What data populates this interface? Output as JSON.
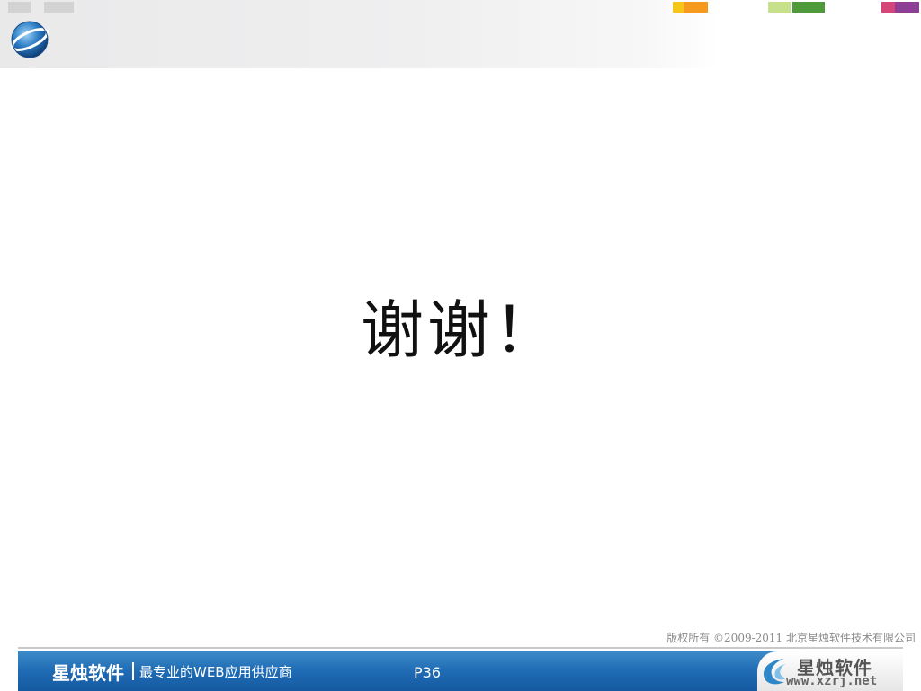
{
  "header": {
    "logo_icon": "globe-orbit-icon",
    "swatches": [
      {
        "name": "swatch-yellow-light",
        "color": "#f5c518"
      },
      {
        "name": "swatch-orange",
        "color": "#f59a1c"
      },
      {
        "name": "swatch-green-light",
        "color": "#c7e08c"
      },
      {
        "name": "swatch-green",
        "color": "#4f9a3a"
      },
      {
        "name": "swatch-pink",
        "color": "#d6457a"
      },
      {
        "name": "swatch-purple",
        "color": "#8d3f95"
      }
    ]
  },
  "slide": {
    "title": "谢谢！"
  },
  "copyright": "版权所有 ©2009-2011 北京星烛软件技术有限公司",
  "footer": {
    "brand": "星烛软件",
    "slogan": "最专业的WEB应用供应商",
    "page_number": "P36",
    "logo_name": "星烛软件",
    "logo_url": "www.xzrj.net",
    "bar_color": "#1f6bb4"
  }
}
